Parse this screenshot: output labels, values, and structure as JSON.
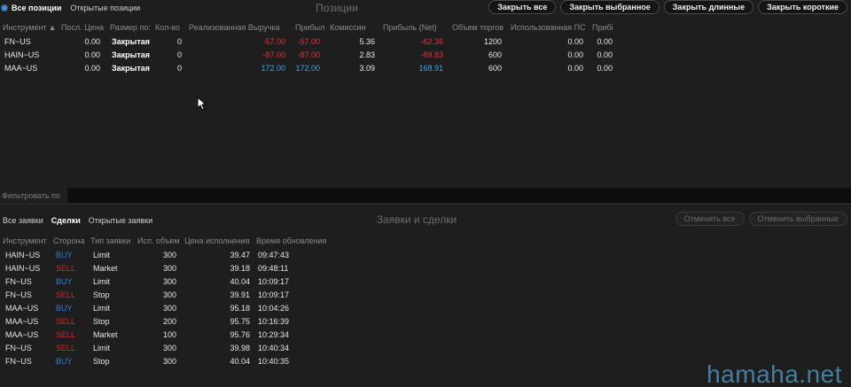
{
  "positions": {
    "tabs": [
      "Все позиции",
      "Открытые позиции"
    ],
    "active_tab": 0,
    "title": "Позиции",
    "buttons": {
      "close_all": "Закрыть все",
      "close_selected": "Закрыть выбранное",
      "close_long": "Закрыть длинные",
      "close_short": "Закрыть короткие"
    },
    "columns": [
      "Инструмент",
      "Посл. Цена",
      "Размер по:",
      "Кол-во",
      "Реализованная Выручка",
      "Прибыл",
      "Комиссии",
      "Прибыль (Net)",
      "Объем торгов",
      "Использованная ПС",
      "Прибі"
    ],
    "sorted_column": "Инструмент",
    "sort_direction": "asc",
    "rows": [
      {
        "instrument": "FN~US",
        "last": "0.00",
        "size": "Закрытая",
        "qty": "0",
        "realized": "-57.00",
        "profit": "-57.00",
        "commission": "5.36",
        "net": "-62.36",
        "volume": "1200",
        "used_bp": "0.00",
        "profit2": "0.00",
        "realized_sign": "neg",
        "net_sign": "neg"
      },
      {
        "instrument": "HAIN~US",
        "last": "0.00",
        "size": "Закрытая",
        "qty": "0",
        "realized": "-87.00",
        "profit": "-87.00",
        "commission": "2.83",
        "net": "-89.83",
        "volume": "600",
        "used_bp": "0.00",
        "profit2": "0.00",
        "realized_sign": "neg",
        "net_sign": "neg"
      },
      {
        "instrument": "MAA~US",
        "last": "0.00",
        "size": "Закрытая",
        "qty": "0",
        "realized": "172.00",
        "profit": "172.00",
        "commission": "3.09",
        "net": "168.91",
        "volume": "600",
        "used_bp": "0.00",
        "profit2": "0.00",
        "realized_sign": "pos",
        "net_sign": "pos"
      }
    ]
  },
  "filter": {
    "label": "Фильтровать по",
    "value": ""
  },
  "orders": {
    "tabs": [
      "Все заявки",
      "Сделки",
      "Открытые заявки"
    ],
    "active_tab": 1,
    "title": "Заявки и сделки",
    "buttons": {
      "cancel_all": "Отменить все",
      "cancel_selected": "Отменить выбранные"
    },
    "columns": [
      "Инструмент",
      "Сторона",
      "Тип заявки",
      "Исп. объем",
      "Цена исполнения",
      "Время обновления"
    ],
    "rows": [
      {
        "instrument": "HAIN~US",
        "side": "BUY",
        "type": "Limit",
        "qty": "300",
        "price": "39.47",
        "time": "09:47:43"
      },
      {
        "instrument": "HAIN~US",
        "side": "SELL",
        "type": "Market",
        "qty": "300",
        "price": "39.18",
        "time": "09:48:11"
      },
      {
        "instrument": "FN~US",
        "side": "BUY",
        "type": "Limit",
        "qty": "300",
        "price": "40.04",
        "time": "10:09:17"
      },
      {
        "instrument": "FN~US",
        "side": "SELL",
        "type": "Stop",
        "qty": "300",
        "price": "39.91",
        "time": "10:09:17"
      },
      {
        "instrument": "MAA~US",
        "side": "BUY",
        "type": "Limit",
        "qty": "300",
        "price": "95.18",
        "time": "10:04:26"
      },
      {
        "instrument": "MAA~US",
        "side": "SELL",
        "type": "Stop",
        "qty": "200",
        "price": "95.75",
        "time": "10:16:39"
      },
      {
        "instrument": "MAA~US",
        "side": "SELL",
        "type": "Market",
        "qty": "100",
        "price": "95.76",
        "time": "10:29:34"
      },
      {
        "instrument": "FN~US",
        "side": "SELL",
        "type": "Limit",
        "qty": "300",
        "price": "39.98",
        "time": "10:40:34"
      },
      {
        "instrument": "FN~US",
        "side": "BUY",
        "type": "Stop",
        "qty": "300",
        "price": "40.04",
        "time": "10:40:35"
      }
    ]
  },
  "watermark": "hamaha.net",
  "colors": {
    "negative": "#e0323c",
    "positive": "#3aa6e8",
    "buy": "#2f7fd0",
    "sell": "#d8272f",
    "sorted_header": "#9bd23a"
  }
}
